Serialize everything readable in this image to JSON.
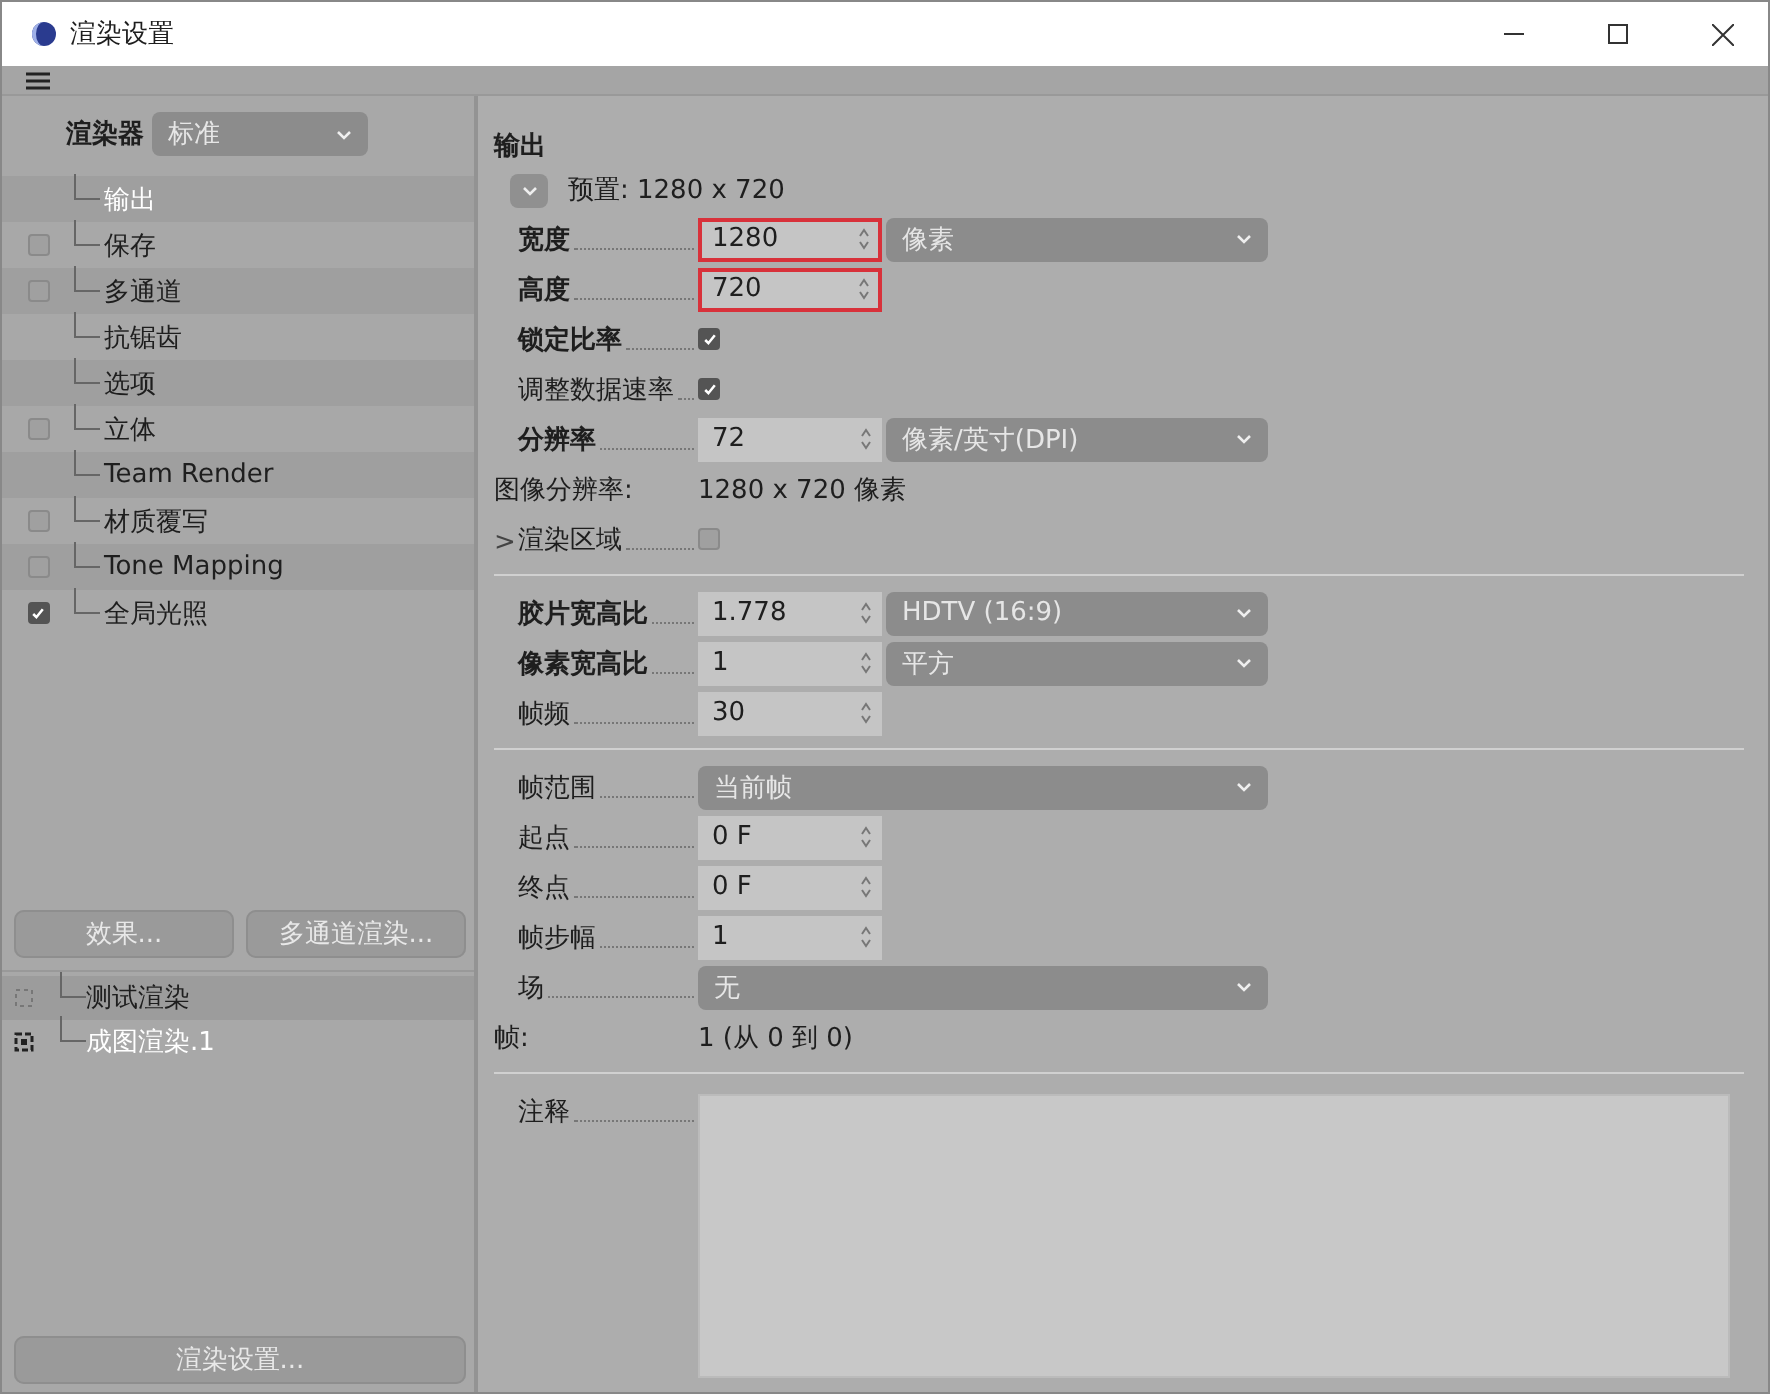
{
  "window": {
    "title": "渲染设置"
  },
  "renderer": {
    "label": "渲染器",
    "value": "标准"
  },
  "settings_tree": [
    {
      "label": "输出",
      "kind": "plain",
      "selected": true
    },
    {
      "label": "保存",
      "kind": "checkbox",
      "checked": false,
      "selected": false
    },
    {
      "label": "多通道",
      "kind": "checkbox",
      "checked": false,
      "selected": false
    },
    {
      "label": "抗锯齿",
      "kind": "plain",
      "selected": false
    },
    {
      "label": "选项",
      "kind": "plain",
      "selected": false
    },
    {
      "label": "立体",
      "kind": "checkbox",
      "checked": false,
      "selected": false
    },
    {
      "label": "Team Render",
      "kind": "plain",
      "selected": false
    },
    {
      "label": "材质覆写",
      "kind": "checkbox",
      "checked": false,
      "selected": false
    },
    {
      "label": "Tone Mapping",
      "kind": "checkbox",
      "checked": false,
      "selected": false
    },
    {
      "label": "全局光照",
      "kind": "checkbox",
      "checked": true,
      "selected": false
    }
  ],
  "panel_buttons": [
    "效果...",
    "多通道渲染..."
  ],
  "render_settings_list": [
    {
      "label": "测试渲染",
      "selected": true,
      "active": false
    },
    {
      "label": "成图渲染.1",
      "selected": false,
      "active": true
    }
  ],
  "render_settings_button": "渲染设置...",
  "output": {
    "title": "输出",
    "preset": "预置: 1280 x 720",
    "groups": [
      [
        {
          "kind": "spin",
          "label": "宽度",
          "bold": true,
          "value": "1280",
          "highlighted": true,
          "unit": "像素"
        },
        {
          "kind": "spin",
          "label": "高度",
          "bold": true,
          "value": "720",
          "highlighted": true
        },
        {
          "kind": "checkbox",
          "label": "锁定比率",
          "bold": true,
          "checked": true
        },
        {
          "kind": "checkbox",
          "label": "调整数据速率",
          "bold": false,
          "checked": true
        },
        {
          "kind": "spin",
          "label": "分辨率",
          "bold": true,
          "value": "72",
          "highlighted": false,
          "unit": "像素/英寸(DPI)"
        },
        {
          "kind": "info",
          "label": "图像分辨率:",
          "value": "1280 x 720 像素"
        },
        {
          "kind": "checkbox",
          "label": "渲染区域",
          "bold": false,
          "checked": false,
          "expander": ">"
        }
      ],
      [
        {
          "kind": "spin",
          "label": "胶片宽高比",
          "bold": true,
          "value": "1.778",
          "highlighted": false,
          "unit": "HDTV (16:9)"
        },
        {
          "kind": "spin",
          "label": "像素宽高比",
          "bold": true,
          "value": "1",
          "highlighted": false,
          "unit": "平方"
        },
        {
          "kind": "spin",
          "label": "帧频",
          "bold": false,
          "value": "30",
          "highlighted": false
        }
      ],
      [
        {
          "kind": "dropdown",
          "label": "帧范围",
          "bold": false,
          "value": "当前帧"
        },
        {
          "kind": "spin",
          "label": "起点",
          "bold": false,
          "value": "0 F",
          "highlighted": false
        },
        {
          "kind": "spin",
          "label": "终点",
          "bold": false,
          "value": "0 F",
          "highlighted": false
        },
        {
          "kind": "spin",
          "label": "帧步幅",
          "bold": false,
          "value": "1",
          "highlighted": false
        },
        {
          "kind": "dropdown",
          "label": "场",
          "bold": false,
          "value": "无"
        },
        {
          "kind": "info",
          "label": "帧:",
          "value": "1 (从 0 到 0)"
        }
      ],
      [
        {
          "kind": "textarea",
          "label": "注释",
          "bold": false
        }
      ]
    ]
  }
}
